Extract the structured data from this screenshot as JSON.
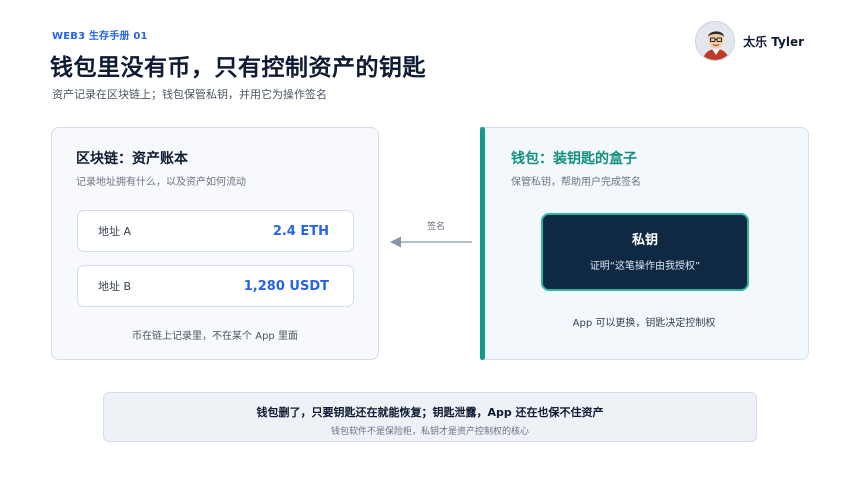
{
  "header": {
    "series": "WEB3 生存手册 01",
    "title": "钱包里没有币，只有控制资产的钥匙",
    "subtitle": "资产记录在区块链上；钱包保管私钥，并用它为操作签名"
  },
  "author": {
    "name": "太乐 Tyler",
    "avatar_icon": "avatar-icon"
  },
  "ledger_card": {
    "title": "区块链：资产账本",
    "desc": "记录地址拥有什么，以及资产如何流动",
    "addresses": [
      {
        "label": "地址 A",
        "value": "2.4 ETH"
      },
      {
        "label": "地址 B",
        "value": "1,280 USDT"
      }
    ],
    "note": "币在链上记录里，不在某个 App 里面"
  },
  "connector": {
    "label": "签名",
    "icon": "arrow-left-icon"
  },
  "wallet_card": {
    "title": "钱包：装钥匙的盒子",
    "desc": "保管私钥，帮助用户完成签名",
    "key_title": "私钥",
    "key_desc": "证明“这笔操作由我授权”",
    "note": "App 可以更换，钥匙决定控制权"
  },
  "banner": {
    "main": "钱包删了，只要钥匙还在就能恢复；钥匙泄露，App 还在也保不住资产",
    "sub": "钱包软件不是保险柜，私钥才是资产控制权的核心"
  },
  "colors": {
    "accent_blue": "#2563eb",
    "accent_teal": "#129a86",
    "key_box_bg": "#0f2942"
  }
}
